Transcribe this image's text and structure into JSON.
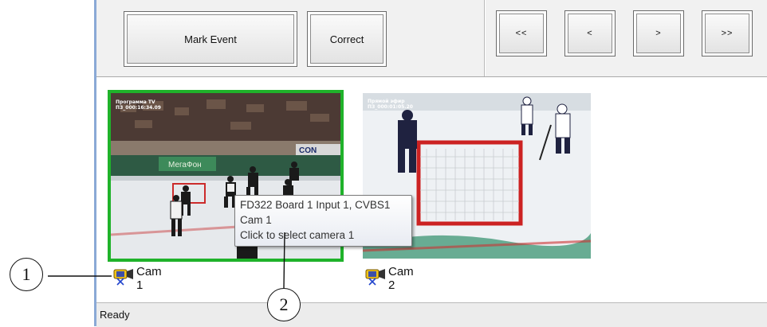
{
  "toolbar": {
    "mark_event_label": "Mark Event",
    "correct_label": "Correct",
    "nav": [
      "<<",
      "<",
      ">",
      ">>"
    ]
  },
  "cameras": [
    {
      "label": "Cam 1",
      "osd_line1": "Программа TV",
      "osd_line2": "ПЗ_000:16:34.09",
      "selected": true
    },
    {
      "label": "Cam 2",
      "osd_line1": "Прямой эфир",
      "osd_line2": "ПЗ_000:01:05.20",
      "selected": false
    }
  ],
  "tooltip": {
    "line1": "FD322 Board 1 Input 1, CVBS1",
    "line2": "Cam 1",
    "line3": "Click to select camera 1"
  },
  "status": {
    "text": "Ready"
  },
  "callouts": [
    "1",
    "2"
  ],
  "colors": {
    "selection": "#1fb22a",
    "window_border": "#8aa9d6"
  },
  "icons": {
    "camera": "camera-icon"
  }
}
